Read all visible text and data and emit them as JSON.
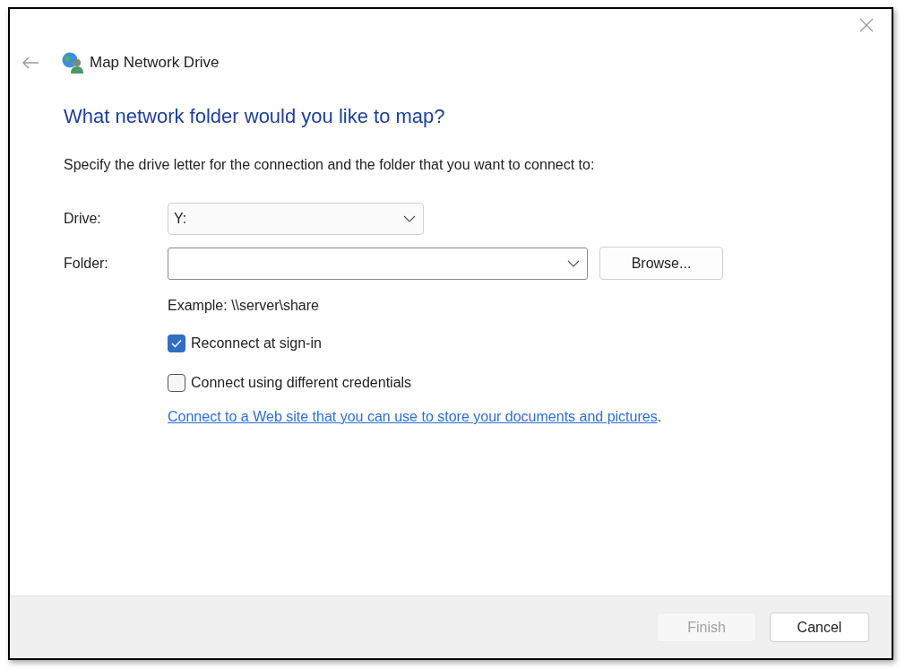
{
  "window": {
    "title": "Map Network Drive"
  },
  "heading": "What network folder would you like to map?",
  "description": "Specify the drive letter for the connection and the folder that you want to connect to:",
  "fields": [
    {
      "label": "Drive:",
      "value": "Y:",
      "kind": "dropdown"
    },
    {
      "label": "Folder:",
      "kind": "combo",
      "button": "Browse..."
    }
  ],
  "example": "Example: \\\\server\\share",
  "options": [
    {
      "label": "Reconnect at sign-in",
      "checked": true
    },
    {
      "label": "Connect using different credentials",
      "checked": false
    }
  ],
  "link": {
    "text": "Connect to a Web site that you can use to store your documents and pictures",
    "suffix": "."
  },
  "buttons": [
    {
      "label": "Finish",
      "disabled": true
    },
    {
      "label": "Cancel",
      "disabled": false
    }
  ]
}
